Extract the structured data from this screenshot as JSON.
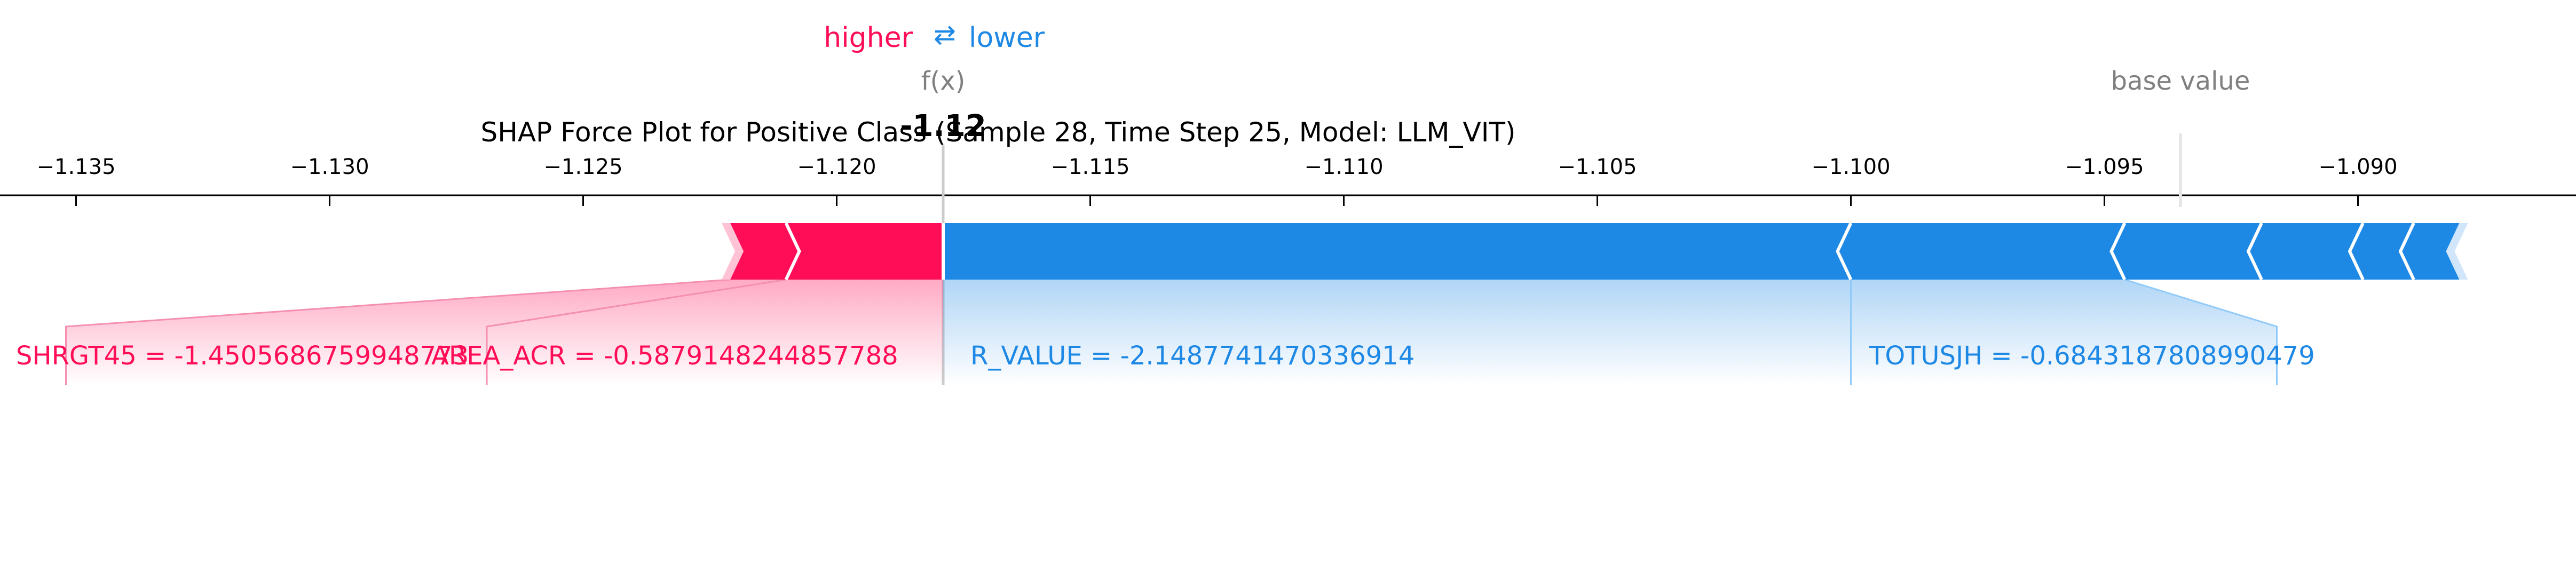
{
  "chart_data": {
    "type": "force",
    "title": "SHAP Force Plot for Positive Class (Sample 28, Time Step 25, Model: LLM_VIT)",
    "legend": {
      "higher": "higher",
      "arrows": "⇄",
      "lower": "lower"
    },
    "fx_label": "f(x)",
    "fx_value": -1.1179,
    "fx_display": "-1.12",
    "base_value_label": "base value",
    "base_value": -1.0935,
    "axis": {
      "xlim": [
        -1.1365,
        -1.0857
      ],
      "ticks": [
        -1.135,
        -1.13,
        -1.125,
        -1.12,
        -1.115,
        -1.11,
        -1.105,
        -1.1,
        -1.095,
        -1.09
      ],
      "tick_labels": [
        "−1.135",
        "−1.130",
        "−1.125",
        "−1.120",
        "−1.115",
        "−1.110",
        "−1.105",
        "−1.100",
        "−1.095",
        "−1.090"
      ]
    },
    "positive_segments": [
      -1.1221,
      -1.121,
      -1.1179
    ],
    "negative_segments": [
      -1.1179,
      -1.1,
      -1.0946,
      -1.0919,
      -1.0899,
      -1.0889,
      -1.088
    ],
    "labels": [
      {
        "text": "SHRGT45 = -1.4505686759948773",
        "side": "higher"
      },
      {
        "text": "AREA_ACR = -0.5879148244857788",
        "side": "higher"
      },
      {
        "text": "R_VALUE = -2.1487741470336914",
        "side": "lower"
      },
      {
        "text": "TOTUSJH = -0.6843187808990479",
        "side": "lower"
      }
    ],
    "colors": {
      "higher": "#ff0d57",
      "lower": "#1e88e5",
      "higher_light": "#ffc3d5",
      "lower_light": "#d1e6fa",
      "muted": "#808080"
    }
  }
}
